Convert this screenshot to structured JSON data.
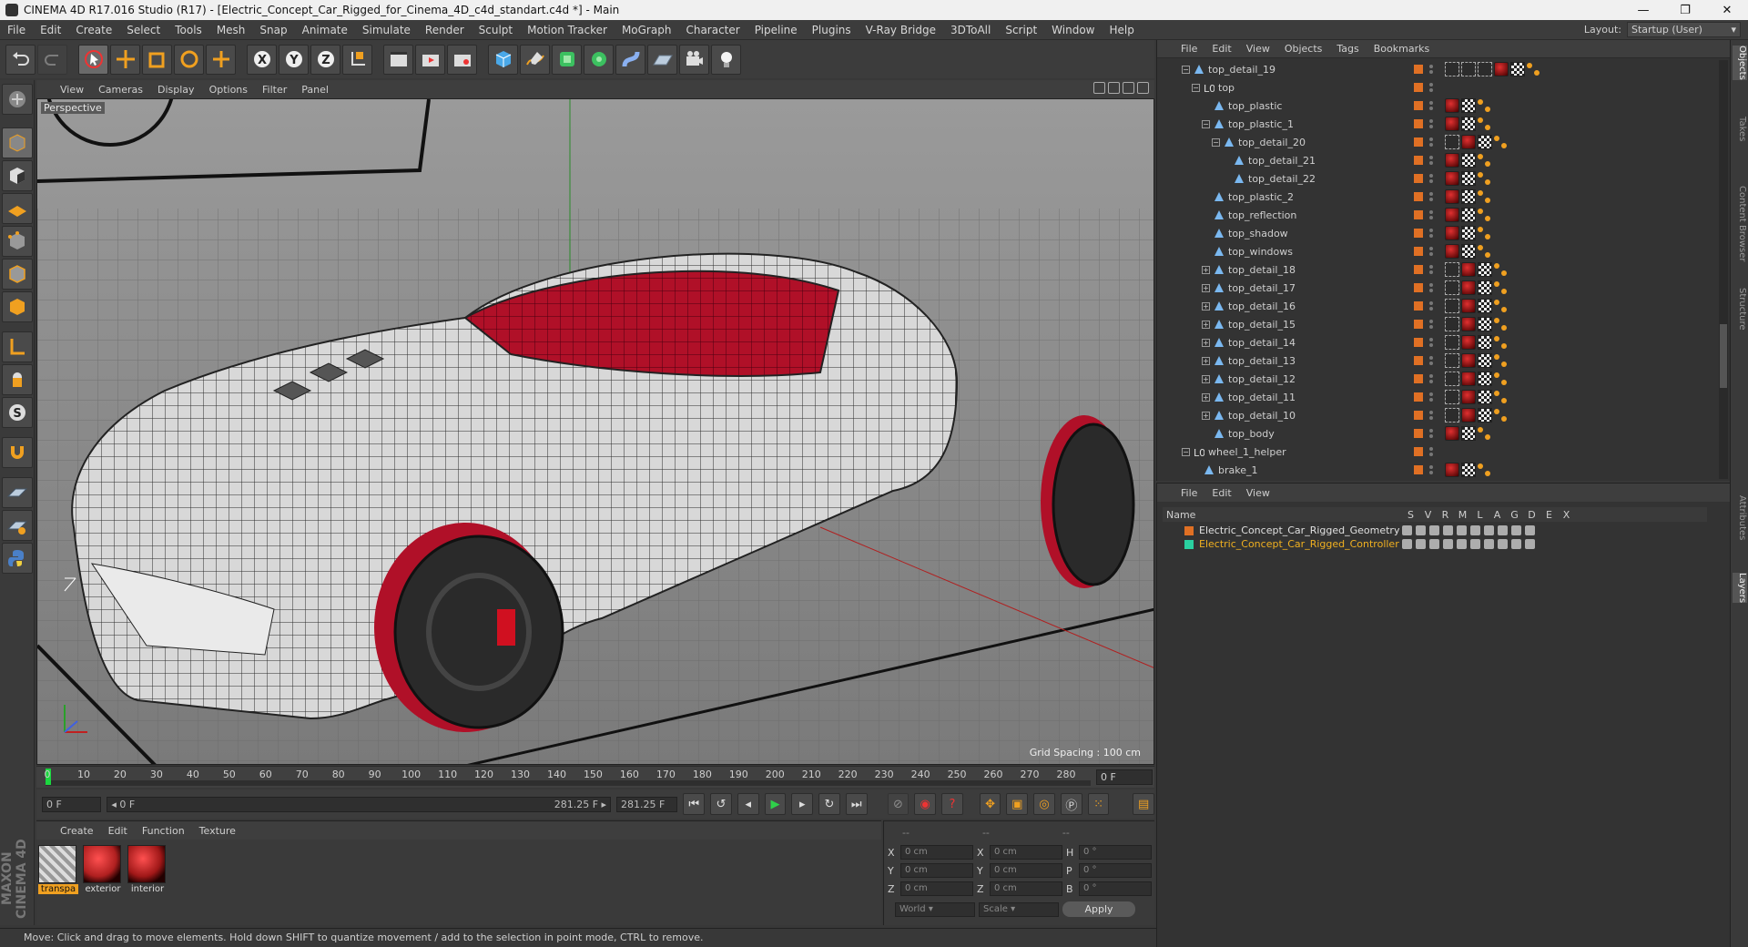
{
  "window": {
    "title": "CINEMA 4D R17.016 Studio (R17) - [Electric_Concept_Car_Rigged_for_Cinema_4D_c4d_standart.c4d *] - Main",
    "min": "—",
    "max": "❐",
    "close": "✕"
  },
  "menubar": [
    "File",
    "Edit",
    "Create",
    "Select",
    "Tools",
    "Mesh",
    "Snap",
    "Animate",
    "Simulate",
    "Render",
    "Sculpt",
    "Motion Tracker",
    "MoGraph",
    "Character",
    "Pipeline",
    "Plugins",
    "V-Ray Bridge",
    "3DToAll",
    "Script",
    "Window",
    "Help"
  ],
  "layout": {
    "label": "Layout:",
    "value": "Startup (User)"
  },
  "viewport": {
    "menu": [
      "View",
      "Cameras",
      "Display",
      "Options",
      "Filter",
      "Panel"
    ],
    "label": "Perspective",
    "grid_spacing": "Grid Spacing : 100 cm"
  },
  "timeline": {
    "ticks": [
      "0",
      "10",
      "20",
      "30",
      "40",
      "50",
      "60",
      "70",
      "80",
      "90",
      "100",
      "110",
      "120",
      "130",
      "140",
      "150",
      "160",
      "170",
      "180",
      "190",
      "200",
      "210",
      "220",
      "230",
      "240",
      "250",
      "260",
      "270",
      "280"
    ],
    "frame": "0 F"
  },
  "transport": {
    "start": "0 F",
    "range_start": "◂ 0 F",
    "range_end": "281.25 F ▸",
    "end": "281.25 F"
  },
  "material_manager": {
    "menu": [
      "Create",
      "Edit",
      "Function",
      "Texture"
    ],
    "materials": [
      {
        "name": "transpa",
        "color": "#bdbdbd"
      },
      {
        "name": "exterior",
        "color": "#b02020"
      },
      {
        "name": "interior",
        "color": "#a01818"
      }
    ]
  },
  "coords": {
    "header": [
      "--",
      "--",
      "--"
    ],
    "rows": [
      {
        "a": "X",
        "av": "0 cm",
        "b": "X",
        "bv": "0 cm",
        "c": "H",
        "cv": "0 °"
      },
      {
        "a": "Y",
        "av": "0 cm",
        "b": "Y",
        "bv": "0 cm",
        "c": "P",
        "cv": "0 °"
      },
      {
        "a": "Z",
        "av": "0 cm",
        "b": "Z",
        "bv": "0 cm",
        "c": "B",
        "cv": "0 °"
      }
    ],
    "world": "World",
    "scale": "Scale",
    "apply": "Apply"
  },
  "status": "Move: Click and drag to move elements. Hold down SHIFT to quantize movement / add to the selection in point mode, CTRL to remove.",
  "maxon": "MAXON CINEMA 4D",
  "object_manager": {
    "menu": [
      "File",
      "Edit",
      "View",
      "Objects",
      "Tags",
      "Bookmarks"
    ],
    "rows": [
      {
        "name": "top_detail_19",
        "depth": 3,
        "exp": "-",
        "tags": "sel"
      },
      {
        "name": "top",
        "depth": 4,
        "exp": "-",
        "tags": "none",
        "null": true
      },
      {
        "name": "top_plastic",
        "depth": 5,
        "exp": "",
        "tags": "r"
      },
      {
        "name": "top_plastic_1",
        "depth": 5,
        "exp": "-",
        "tags": "r"
      },
      {
        "name": "top_detail_20",
        "depth": 6,
        "exp": "-",
        "tags": "sr"
      },
      {
        "name": "top_detail_21",
        "depth": 7,
        "exp": "",
        "tags": "r"
      },
      {
        "name": "top_detail_22",
        "depth": 7,
        "exp": "",
        "tags": "r"
      },
      {
        "name": "top_plastic_2",
        "depth": 5,
        "exp": "",
        "tags": "r"
      },
      {
        "name": "top_reflection",
        "depth": 5,
        "exp": "",
        "tags": "r"
      },
      {
        "name": "top_shadow",
        "depth": 5,
        "exp": "",
        "tags": "r"
      },
      {
        "name": "top_windows",
        "depth": 5,
        "exp": "",
        "tags": "r"
      },
      {
        "name": "top_detail_18",
        "depth": 5,
        "exp": "+",
        "tags": "sr"
      },
      {
        "name": "top_detail_17",
        "depth": 5,
        "exp": "+",
        "tags": "sr"
      },
      {
        "name": "top_detail_16",
        "depth": 5,
        "exp": "+",
        "tags": "sr"
      },
      {
        "name": "top_detail_15",
        "depth": 5,
        "exp": "+",
        "tags": "sr"
      },
      {
        "name": "top_detail_14",
        "depth": 5,
        "exp": "+",
        "tags": "sr"
      },
      {
        "name": "top_detail_13",
        "depth": 5,
        "exp": "+",
        "tags": "sr"
      },
      {
        "name": "top_detail_12",
        "depth": 5,
        "exp": "+",
        "tags": "sr"
      },
      {
        "name": "top_detail_11",
        "depth": 5,
        "exp": "+",
        "tags": "sr"
      },
      {
        "name": "top_detail_10",
        "depth": 5,
        "exp": "+",
        "tags": "sr"
      },
      {
        "name": "top_body",
        "depth": 5,
        "exp": "",
        "tags": "r"
      },
      {
        "name": "wheel_1_helper",
        "depth": 3,
        "exp": "-",
        "tags": "none",
        "null": true
      },
      {
        "name": "brake_1",
        "depth": 4,
        "exp": "",
        "tags": "r"
      }
    ]
  },
  "layer_manager": {
    "menu": [
      "File",
      "Edit",
      "View"
    ],
    "header": {
      "name": "Name",
      "cols": [
        "S",
        "V",
        "R",
        "M",
        "L",
        "A",
        "G",
        "D",
        "E",
        "X"
      ]
    },
    "layers": [
      {
        "name": "Electric_Concept_Car_Rigged_Geometry",
        "color": "#e07024",
        "text": "#e0e0e0"
      },
      {
        "name": "Electric_Concept_Car_Rigged_Controllers",
        "color": "#2ad0a0",
        "text": "#f0b020"
      }
    ]
  },
  "side_tabs": [
    "Objects",
    "Takes",
    "Content Browser",
    "Structure",
    "Attributes",
    "Layers"
  ]
}
